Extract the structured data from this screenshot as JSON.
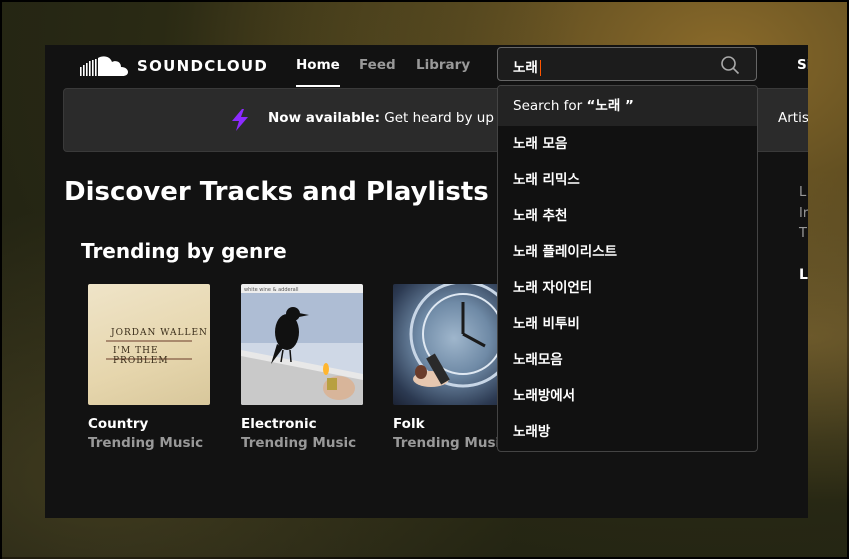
{
  "header": {
    "brand": "SOUNDCLOUD",
    "nav": [
      {
        "label": "Home",
        "active": true
      },
      {
        "label": "Feed",
        "active": false
      },
      {
        "label": "Library",
        "active": false
      }
    ],
    "search": {
      "value": "노래"
    },
    "signin_label": "Si"
  },
  "banner": {
    "bold_text": "Now available:",
    "text": " Get heard by up to",
    "tail_text": "Artist or",
    "accent_color": "#8c2bff"
  },
  "main": {
    "title": "Discover Tracks and Playlists",
    "section_title": "Trending by genre",
    "sidebar_fragments": [
      "L",
      "Ir",
      "T"
    ],
    "sidebar_bold": "L",
    "cards": [
      {
        "title": "Country",
        "subtitle": "Trending Music",
        "art_text_1": "JORDAN WALLEN",
        "art_text_2": "I'M THE PROBLEM"
      },
      {
        "title": "Electronic",
        "subtitle": "Trending Music",
        "art_text_1": "white wine & adderall"
      },
      {
        "title": "Folk",
        "subtitle": "Trending Music"
      }
    ]
  },
  "dropdown": {
    "search_for_label": "Search for ",
    "search_for_query": "“노래 ”",
    "suggestions": [
      "노래 모음",
      "노래 리믹스",
      "노래 추천",
      "노래 플레이리스트",
      "노래 자이언티",
      "노래 비투비",
      "노래모음",
      "노래방에서",
      "노래방"
    ]
  },
  "colors": {
    "accent": "#ff5500",
    "background": "#121212",
    "text_muted": "#999999"
  }
}
